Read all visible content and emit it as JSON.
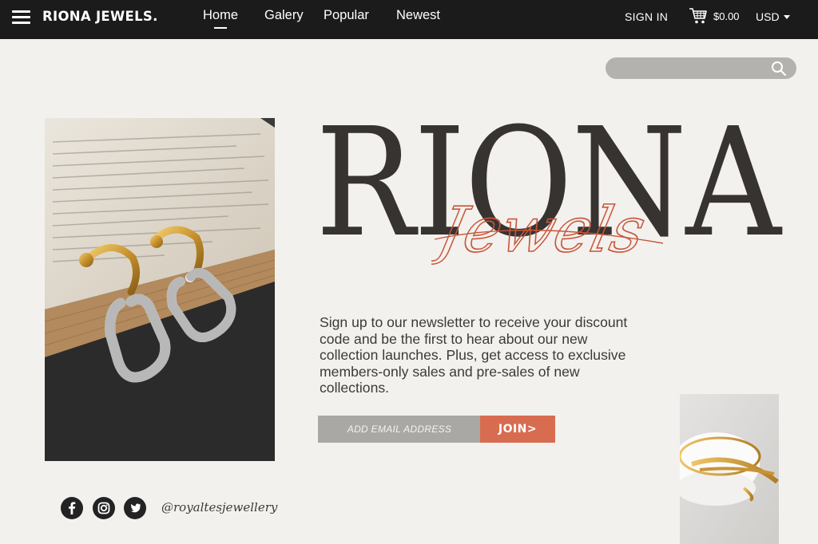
{
  "header": {
    "brand": "RIONA JEWELS.",
    "nav": [
      "Home",
      "Galery",
      "Popular",
      "Newest"
    ],
    "active_nav": "Home",
    "sign_in": "SIGN IN",
    "cart_total": "$0.00",
    "currency": "USD"
  },
  "search": {
    "placeholder": ""
  },
  "hero": {
    "logo_main": "RIONA",
    "logo_script": "Jewels",
    "newsletter_text": "Sign up to our newsletter to receive your discount code and be the first to hear about our new collection launches. Plus, get access to exclusive members-only sales and pre-sales of new collections.",
    "email_placeholder": "ADD EMAIL ADDRESS",
    "join_label": "JOIN>"
  },
  "social": {
    "icons": [
      "facebook-icon",
      "instagram-icon",
      "twitter-icon"
    ],
    "handle": "@royaltesjewellery"
  },
  "colors": {
    "topbar": "#1b1b1b",
    "background": "#f3f1ee",
    "accent": "#d86c50",
    "logo_text": "#373331",
    "input_gray": "#a9a8a4"
  }
}
